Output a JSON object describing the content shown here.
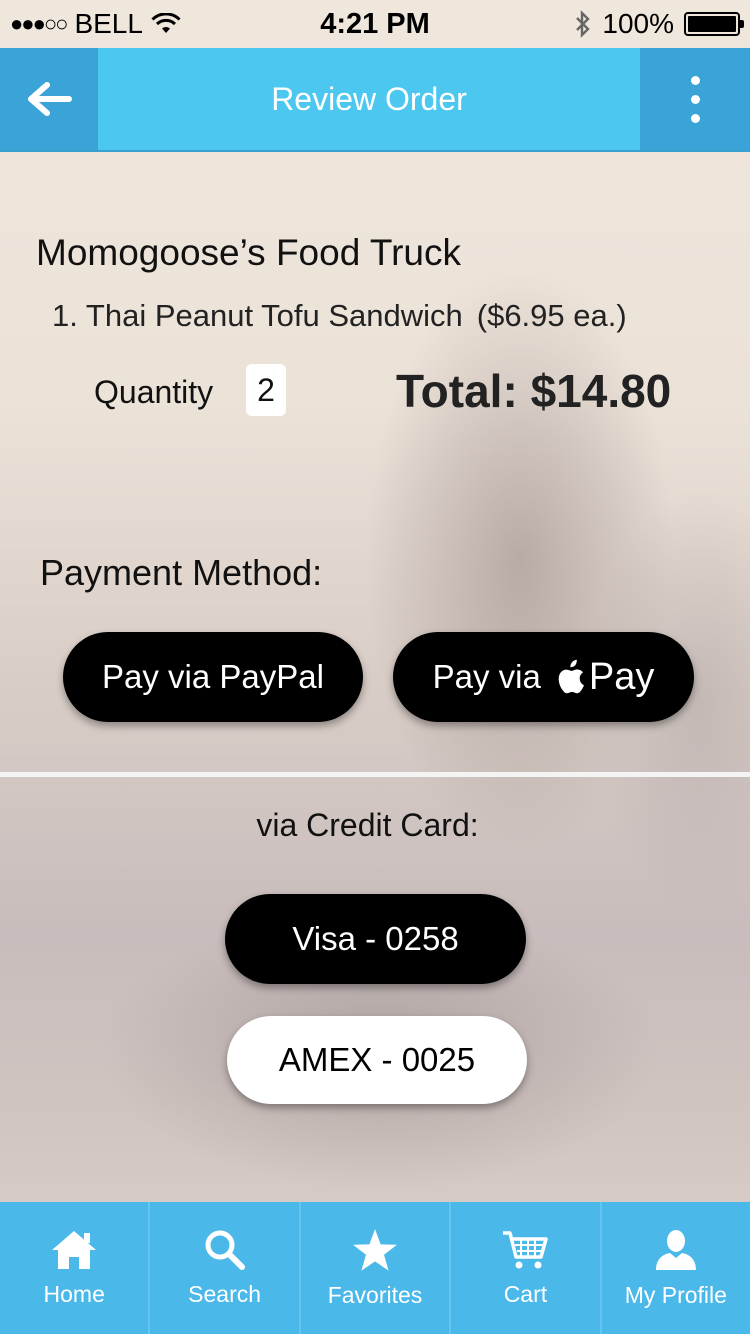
{
  "status_bar": {
    "carrier": "BELL",
    "signal_dots": "●●●○○",
    "time": "4:21 PM",
    "battery": "100%"
  },
  "nav": {
    "title": "Review Order",
    "back_icon": "arrow-left-icon",
    "more_icon": "more-vertical-icon",
    "accent": "#4cc8f0"
  },
  "order": {
    "vendor": "Momogoose’s Food Truck",
    "item": "1. Thai Peanut Tofu Sandwich",
    "unit_price": "($6.95 ea.)",
    "quantity_label": "Quantity",
    "quantity": "2",
    "total": "Total: $14.80"
  },
  "payment": {
    "heading": "Payment Method:",
    "paypal_label": "Pay via PayPal",
    "applepay_prefix": "Pay via",
    "applepay_word": "Pay",
    "credit_heading": "via Credit Card:",
    "cards": [
      {
        "label": "Visa - 0258"
      },
      {
        "label": "AMEX - 0025"
      }
    ]
  },
  "tabbar": {
    "tabs": [
      {
        "label": "Home",
        "icon": "home-icon"
      },
      {
        "label": "Search",
        "icon": "search-icon"
      },
      {
        "label": "Favorites",
        "icon": "star-icon"
      },
      {
        "label": "Cart",
        "icon": "cart-icon"
      },
      {
        "label": "My Profile",
        "icon": "user-icon"
      }
    ],
    "color": "#4bb8ea"
  }
}
